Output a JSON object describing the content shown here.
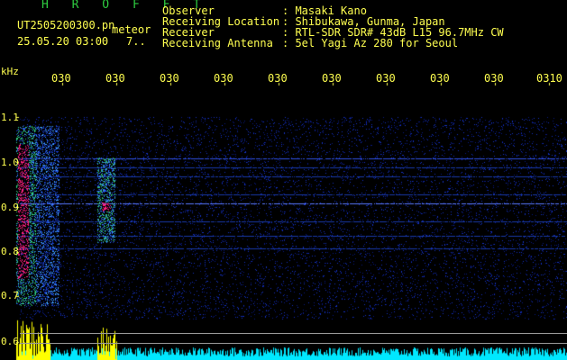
{
  "header": {
    "app_title": "H R O F F T",
    "filename": "UT2505200300.pn",
    "tag": "meteor",
    "datetime": "25.05.20 03:00",
    "count": "7..",
    "fields": [
      {
        "label": "Observer",
        "value": ": Masaki Kano"
      },
      {
        "label": "Receiving Location",
        "value": ": Shibukawa, Gunma, Japan"
      },
      {
        "label": "Receiver",
        "value": ": RTL-SDR SDR# 43dB L15 96.7MHz CW"
      },
      {
        "label": "Receiving Antenna",
        "value": ": 5el Yagi Az 280 for Seoul"
      }
    ]
  },
  "axis": {
    "y_unit": "kHz",
    "y_labels": [
      "1.1",
      "1.0",
      "0.9",
      "0.8",
      "0.7",
      "0.6"
    ],
    "x_labels": [
      "030",
      "030",
      "030",
      "030",
      "030",
      "030",
      "030",
      "030",
      "030",
      "0310"
    ]
  },
  "colors": {
    "text": "#ffff50",
    "title": "#2ecc40",
    "background": "#000000",
    "echo": "#ff2080",
    "noise": "#1030c0",
    "amplitude": "#ffff00",
    "floor": "#00ffff"
  }
}
